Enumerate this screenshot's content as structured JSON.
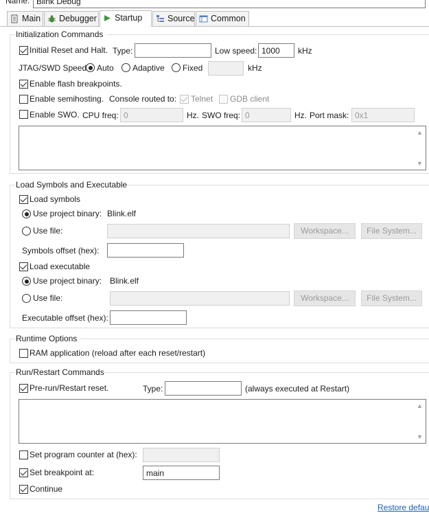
{
  "header": {
    "name_label": "Name:",
    "name_value": "Blink Debug"
  },
  "tabs": [
    {
      "label": "Main"
    },
    {
      "label": "Debugger"
    },
    {
      "label": "Startup"
    },
    {
      "label": "Source"
    },
    {
      "label": "Common"
    }
  ],
  "init": {
    "title": "Initialization Commands",
    "reset_halt_label": "Initial Reset and Halt.",
    "type_label": "Type:",
    "type_value": "",
    "low_speed_label": "Low speed:",
    "low_speed_value": "1000",
    "khz1": "kHz",
    "jtag_label": "JTAG/SWD Speed:",
    "auto_label": "Auto",
    "adaptive_label": "Adaptive",
    "fixed_label": "Fixed",
    "fixed_value": "",
    "khz2": "kHz",
    "flash_bp_label": "Enable flash breakpoints.",
    "semihost_label": "Enable semihosting.",
    "console_label": "Console routed to:",
    "telnet_label": "Telnet",
    "gdb_label": "GDB client",
    "swo_label": "Enable SWO.",
    "cpu_freq_label": "CPU freq:",
    "cpu_freq_value": "0",
    "hz1": "Hz.",
    "swo_freq_label": "SWO freq:",
    "swo_freq_value": "0",
    "hz2": "Hz.",
    "port_mask_label": "Port mask:",
    "port_mask_value": "0x1"
  },
  "load": {
    "title": "Load Symbols and Executable",
    "load_symbols_label": "Load symbols",
    "use_project_binary_label": "Use project binary:",
    "project_binary_value": "Blink.elf",
    "use_file_label": "Use file:",
    "workspace_label": "Workspace...",
    "filesystem_label": "File System...",
    "symbols_offset_label": "Symbols offset (hex):",
    "symbols_offset_value": "",
    "load_exec_label": "Load executable",
    "exec_project_binary_label": "Use project binary:",
    "exec_project_binary_value": "Blink.elf",
    "exec_use_file_label": "Use file:",
    "exec_workspace_label": "Workspace...",
    "exec_filesystem_label": "File System...",
    "exec_offset_label": "Executable offset (hex):",
    "exec_offset_value": ""
  },
  "runtime": {
    "title": "Runtime Options",
    "ram_app_label": "RAM application (reload after each reset/restart)"
  },
  "run": {
    "title": "Run/Restart Commands",
    "prerun_label": "Pre-run/Restart reset.",
    "type_label": "Type:",
    "type_value": "",
    "always_label": "(always executed at Restart)",
    "set_pc_label": "Set program counter at (hex):",
    "set_pc_value": "",
    "set_bp_label": "Set breakpoint at:",
    "set_bp_value": "main",
    "continue_label": "Continue"
  },
  "footer": {
    "restore_label": "Restore defaults"
  }
}
